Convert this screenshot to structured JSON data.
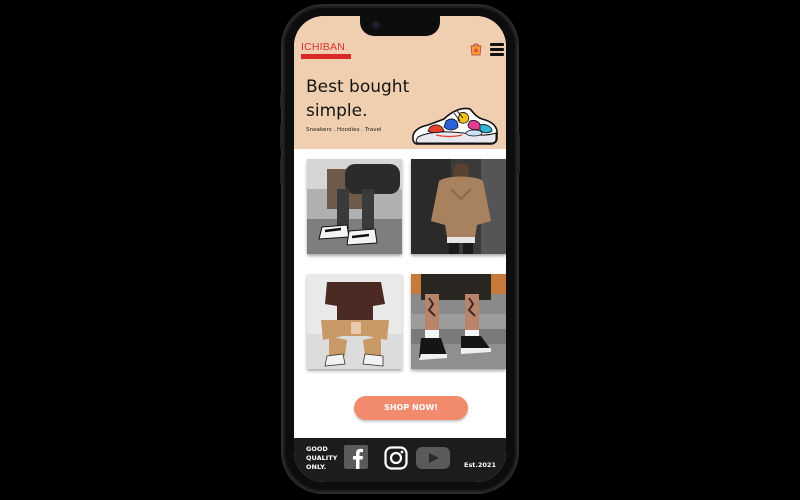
{
  "brand": {
    "name": "ICHIBAN",
    "accent": "#d83030"
  },
  "header": {
    "cart_icon": "shopping-bag-icon",
    "menu_icon": "hamburger-menu-icon"
  },
  "hero": {
    "headline_line1": "Best bought",
    "headline_line2": "simple.",
    "tagline": "Sneakers . Hoodies . Travel",
    "background": "#f0cfb0"
  },
  "gallery": {
    "photos": [
      "sneakers-on-stairs-photo",
      "hoodie-outfit-photo",
      "brown-tee-outfit-photo",
      "converse-on-steps-photo"
    ]
  },
  "cta": {
    "label": "SHOP NOW!",
    "color": "#f28a6e"
  },
  "footer": {
    "slogan_line1": "GOOD",
    "slogan_line2": "QUALITY",
    "slogan_line3": "ONLY.",
    "established": "Est.2021",
    "social_icons": [
      "facebook-icon",
      "instagram-icon",
      "youtube-icon"
    ]
  }
}
